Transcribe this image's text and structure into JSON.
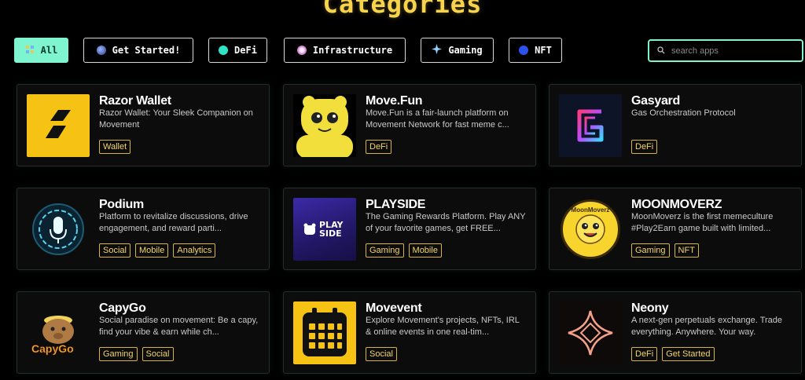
{
  "header": {
    "title": "Categories"
  },
  "filters": [
    {
      "label": "All",
      "icon": "all-icon",
      "active": true
    },
    {
      "label": "Get Started!",
      "icon": "globe-icon",
      "active": false
    },
    {
      "label": "DeFi",
      "icon": "defi-dot-icon",
      "active": false
    },
    {
      "label": "Infrastructure",
      "icon": "infrastructure-icon",
      "active": false
    },
    {
      "label": "Gaming",
      "icon": "gaming-icon",
      "active": false
    },
    {
      "label": "NFT",
      "icon": "nft-dot-icon",
      "active": false
    }
  ],
  "search": {
    "placeholder": "search apps",
    "value": ""
  },
  "apps": [
    {
      "name": "Razor Wallet",
      "description": "Razor Wallet: Your Sleek Companion on Movement",
      "tags": [
        "Wallet"
      ],
      "logo": "razor-logo"
    },
    {
      "name": "Move.Fun",
      "description": "Move.Fun is a fair-launch platform on Movement Network for fast meme c...",
      "tags": [
        "DeFi"
      ],
      "logo": "move-fun-logo"
    },
    {
      "name": "Gasyard",
      "description": "Gas Orchestration Protocol",
      "tags": [
        "DeFi"
      ],
      "logo": "gasyard-logo"
    },
    {
      "name": "Podium",
      "description": "Platform to revitalize discussions, drive engagement, and reward parti...",
      "tags": [
        "Social",
        "Mobile",
        "Analytics"
      ],
      "logo": "podium-logo"
    },
    {
      "name": "PLAYSIDE",
      "description": "The Gaming Rewards Platform. Play ANY of your favorite games, get FREE...",
      "tags": [
        "Gaming",
        "Mobile"
      ],
      "logo": "playside-logo",
      "logo_text": "PLAY SIDE"
    },
    {
      "name": "MOONMOVERZ",
      "description": "MoonMoverz is the first memeculture #Play2Earn game built with limited...",
      "tags": [
        "Gaming",
        "NFT"
      ],
      "logo": "moonmoverz-logo",
      "logo_text": "MoonMoverz"
    },
    {
      "name": "CapyGo",
      "description": "Social paradise on movement: Be a capy, find your vibe & earn while ch...",
      "tags": [
        "Gaming",
        "Social"
      ],
      "logo": "capygo-logo",
      "logo_text": "CapyGo"
    },
    {
      "name": "Movevent",
      "description": "Explore Movement's projects, NFTs, IRL & online events in one real-tim...",
      "tags": [
        "Social"
      ],
      "logo": "movevent-logo"
    },
    {
      "name": "Neony",
      "description": "A next-gen perpetuals exchange. Trade everything. Anywhere. Your way.",
      "tags": [
        "DeFi",
        "Get Started"
      ],
      "logo": "neony-logo"
    }
  ]
}
